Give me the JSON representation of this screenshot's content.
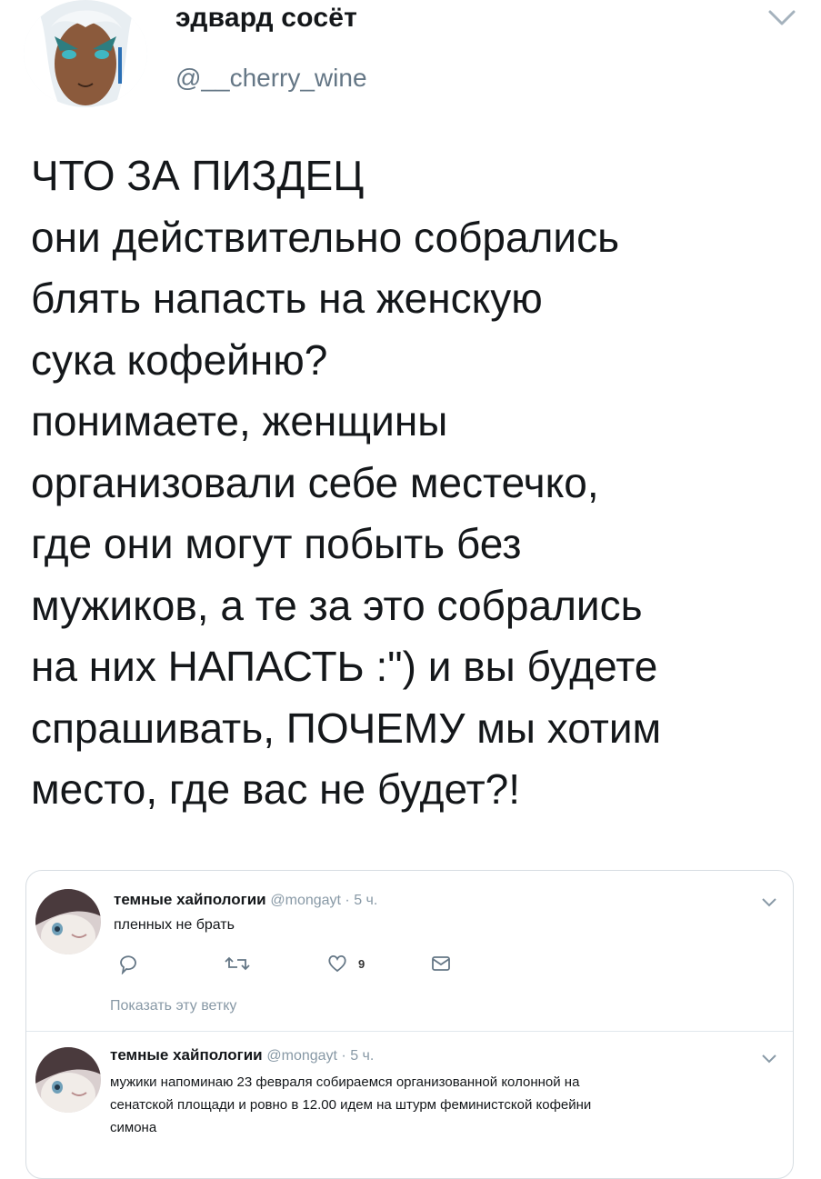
{
  "header": {
    "display_name": "эдвард сосёт",
    "handle": "@__cherry_wine",
    "caret_icon": "chevron-down-icon"
  },
  "tweet": {
    "lines": [
      "ЧТО ЗА ПИЗДЕЦ",
      "они действительно собрались",
      "блять напасть на женскую",
      "сука кофейню?",
      "понимаете, женщины",
      "организовали себе местечко,",
      "где они могут побыть без",
      "мужиков, а те за это собрались",
      "на них НАПАСТЬ :\") и вы будете",
      "спрашивать, ПОЧЕМУ мы хотим",
      "место, где вас не будет?!"
    ]
  },
  "quoted": {
    "first": {
      "name": "темные хайпологии",
      "meta": "@mongayt · 5 ч.",
      "text": "пленных не брать",
      "reply_icon": "reply-icon",
      "retweet_icon": "retweet-icon",
      "like_icon": "heart-icon",
      "like_count": "9",
      "dm_icon": "envelope-icon",
      "show_thread": "Показать эту ветку"
    },
    "second": {
      "name": "темные хайпологии",
      "meta": "@mongayt · 5 ч.",
      "text_lines": [
        "мужики напоминаю 23 февраля собираемся организованной колонной на",
        "сенатской площади и ровно в 12.00 идем на штурм феминистской кофейни",
        "симона"
      ]
    }
  },
  "colors": {
    "text": "#14171a",
    "secondary": "#657786",
    "muted": "#8899a6",
    "border": "#d7dde2"
  }
}
